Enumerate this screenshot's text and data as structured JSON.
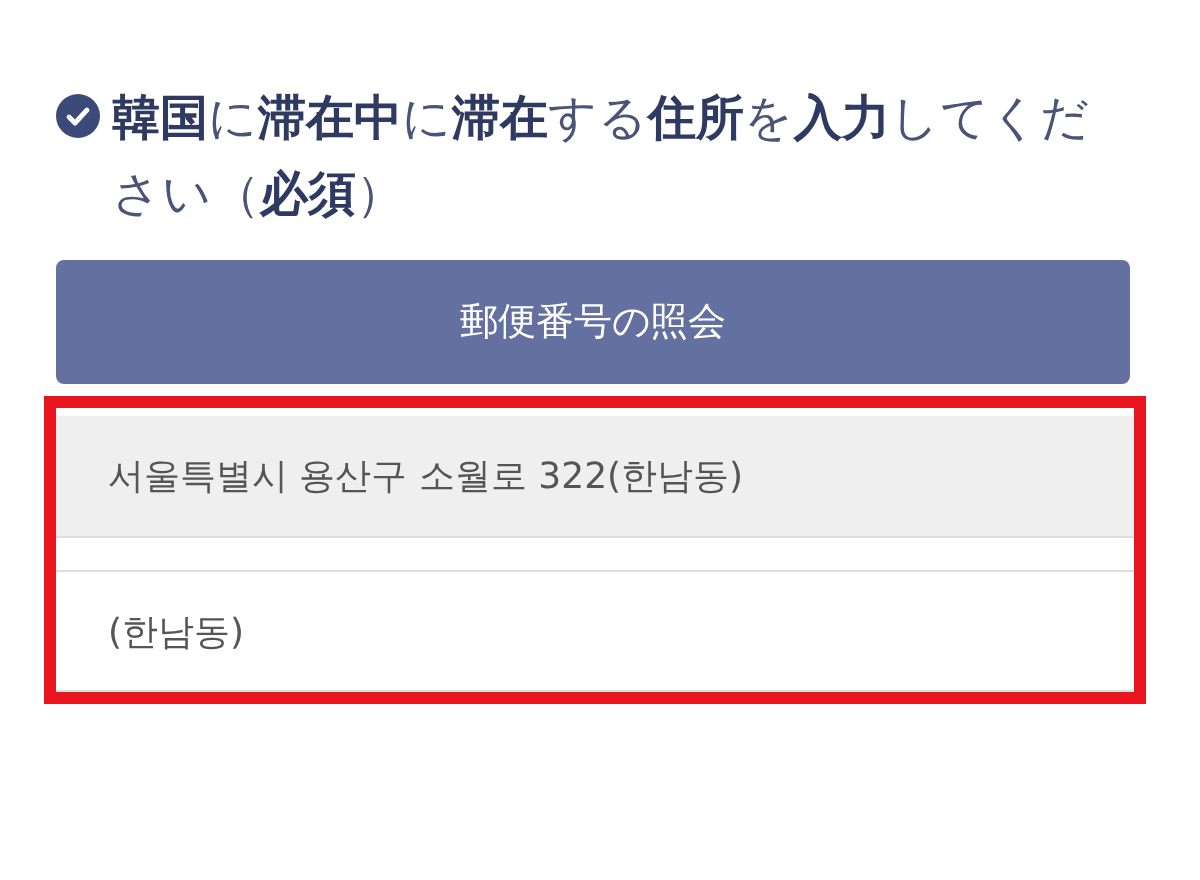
{
  "question": {
    "answered": true,
    "text": "**韓国**に**滞在中**に**滞在**する**住所**を**入力**してください（**必須**）"
  },
  "lookup_button": {
    "label": "郵便番号の照会"
  },
  "fields": [
    {
      "value": "서울특별시 용산구 소월로 322(한남동)",
      "disabled": true
    },
    {
      "value": "(한남동)",
      "disabled": false
    }
  ]
}
